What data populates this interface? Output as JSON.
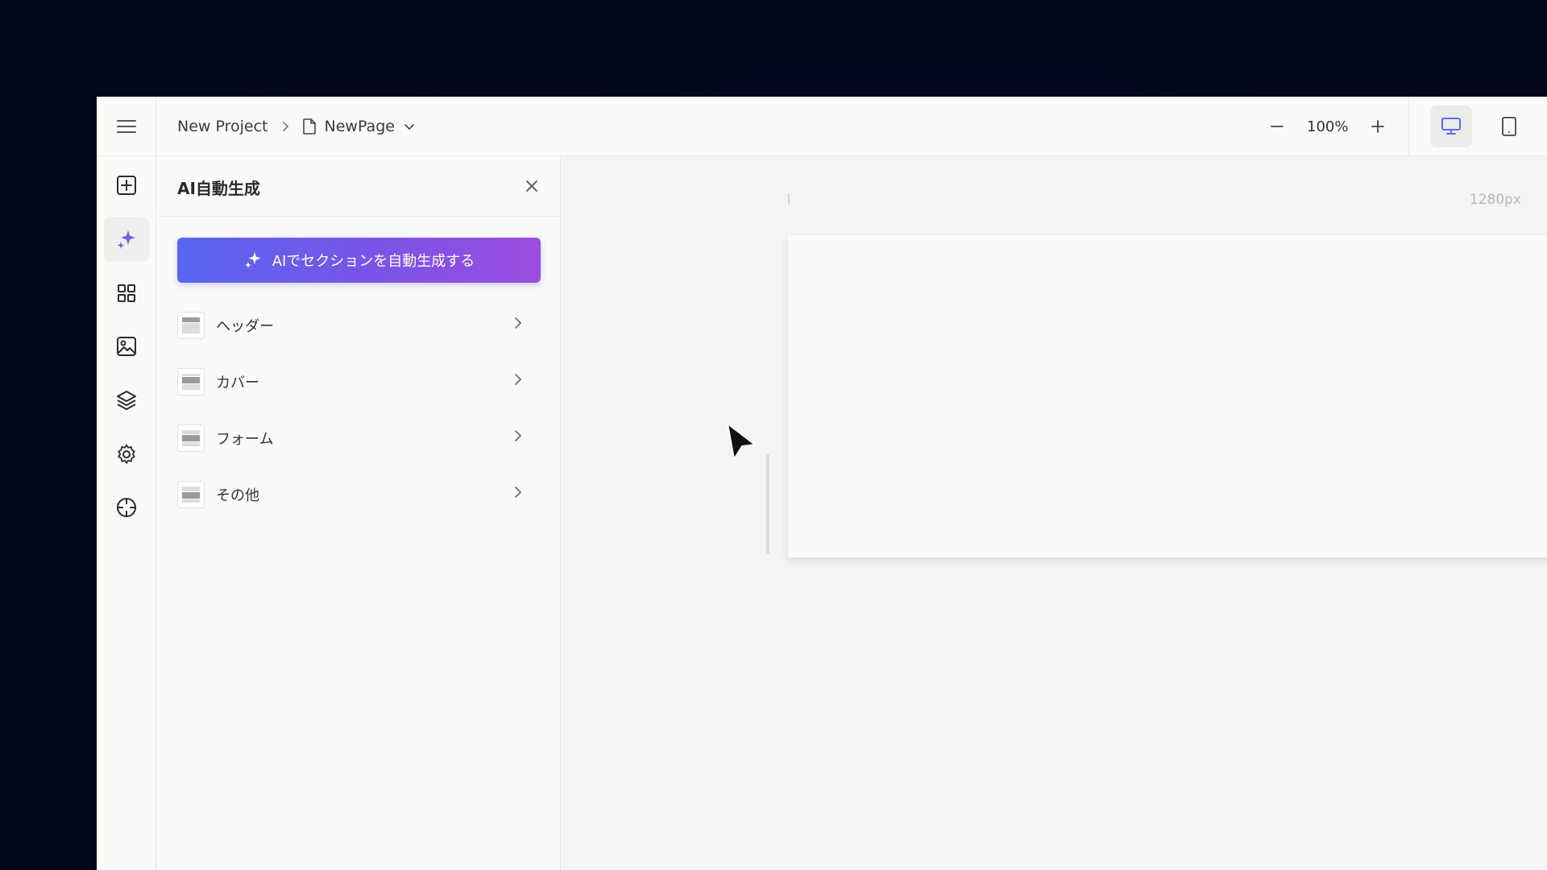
{
  "topbar": {
    "project_name": "New Project",
    "page_name": "NewPage",
    "zoom_level": "100%"
  },
  "panel": {
    "title": "AI自動生成",
    "ai_button_label": "AIでセクションを自動生成する",
    "categories": [
      {
        "label": "ヘッダー"
      },
      {
        "label": "カバー"
      },
      {
        "label": "フォーム"
      },
      {
        "label": "その他"
      }
    ]
  },
  "canvas": {
    "width_label": "1280px"
  },
  "rail": {
    "items": [
      "add-icon",
      "sparkle-icon",
      "grid-icon",
      "image-icon",
      "layers-icon",
      "gear-icon",
      "crosshair-icon"
    ],
    "active": "sparkle-icon"
  },
  "colors": {
    "accent_start": "#5866f0",
    "accent_end": "#9c4ddf",
    "desktop_active": "#5b6cf0"
  }
}
